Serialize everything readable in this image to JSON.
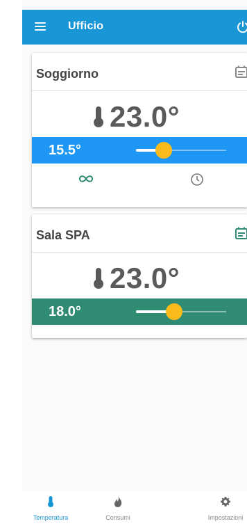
{
  "appbar": {
    "title": "Ufficio"
  },
  "rooms": [
    {
      "name": "Soggiorno",
      "temperature": "23.0°",
      "setpoint": "15.5°",
      "slider_fraction": 0.31,
      "bar_color": "#1e96f3",
      "calendar_color": "#888888"
    },
    {
      "name": "Sala SPA",
      "temperature": "23.0°",
      "setpoint": "18.0°",
      "slider_fraction": 0.42,
      "bar_color": "#2f8b72",
      "calendar_color": "#2f8b72"
    }
  ],
  "bottom_nav": [
    {
      "label": "Temperatura",
      "icon": "thermometer-icon",
      "active": true
    },
    {
      "label": "Consumi",
      "icon": "flame-icon",
      "active": false
    },
    {
      "label": "Impostazioni",
      "icon": "gear-icon",
      "active": false
    }
  ],
  "colors": {
    "primary": "#1896d6",
    "thumb": "#fbbb1d",
    "icon_green": "#2f8b72"
  }
}
